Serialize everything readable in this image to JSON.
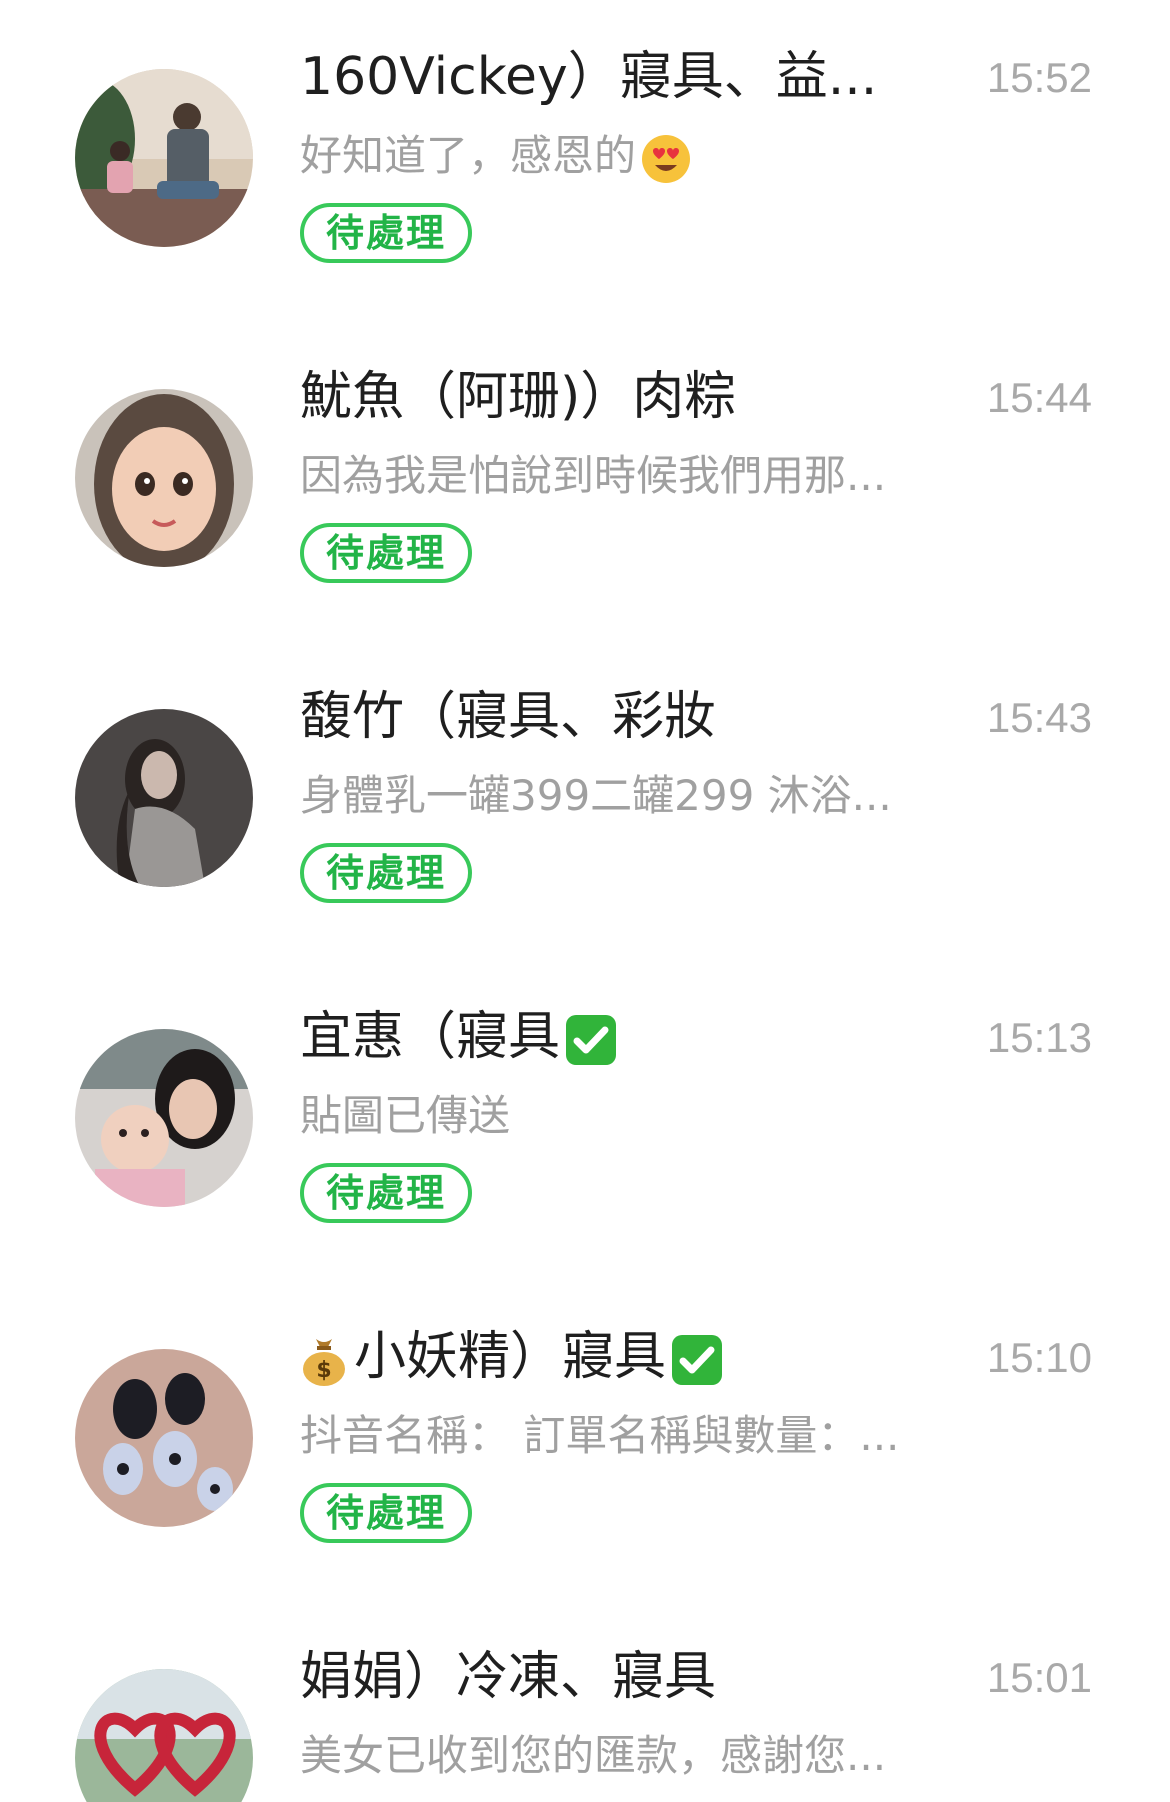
{
  "chats": [
    {
      "name": "160Vickey）寢具、益...",
      "time": "15:52",
      "preview": "好知道了，感恩的",
      "preview_emoji": "heart-eyes-emoji",
      "status": "待處理",
      "avatar": "photo-two-people-sitting"
    },
    {
      "name": "魷魚（阿珊)）肉粽",
      "time": "15:44",
      "preview": "因為我是怕說到時候我們用那...",
      "status": "待處理",
      "avatar": "cartoon-girl-portrait"
    },
    {
      "name": "馥竹（寢具、彩妝",
      "time": "15:43",
      "preview": "身體乳一罐399二罐299 沐浴...",
      "status": "待處理",
      "avatar": "dark-portrait-woman"
    },
    {
      "name": "宜惠（寢具",
      "name_emoji": "check-mark-button-emoji",
      "time": "15:13",
      "preview": "貼圖已傳送",
      "status": "待處理",
      "avatar": "mother-and-baby-photo"
    },
    {
      "name_prefix_emoji": "money-bag-emoji",
      "name": "小妖精）寢具",
      "name_emoji": "check-mark-button-emoji",
      "time": "15:10",
      "preview": "抖音名稱： 訂單名稱與數量：...",
      "status": "待處理",
      "avatar": "painted-nails-photo"
    },
    {
      "name": "娟娟）冷凍、寢具",
      "time": "15:01",
      "preview": "美女已收到您的匯款，感謝您...",
      "avatar": "heart-sculpture-photo"
    }
  ],
  "colors": {
    "accent_green": "#38c95a",
    "time_gray": "#a9a9a9",
    "preview_gray": "#a0a0a0",
    "name_text": "#1f1f1f"
  }
}
